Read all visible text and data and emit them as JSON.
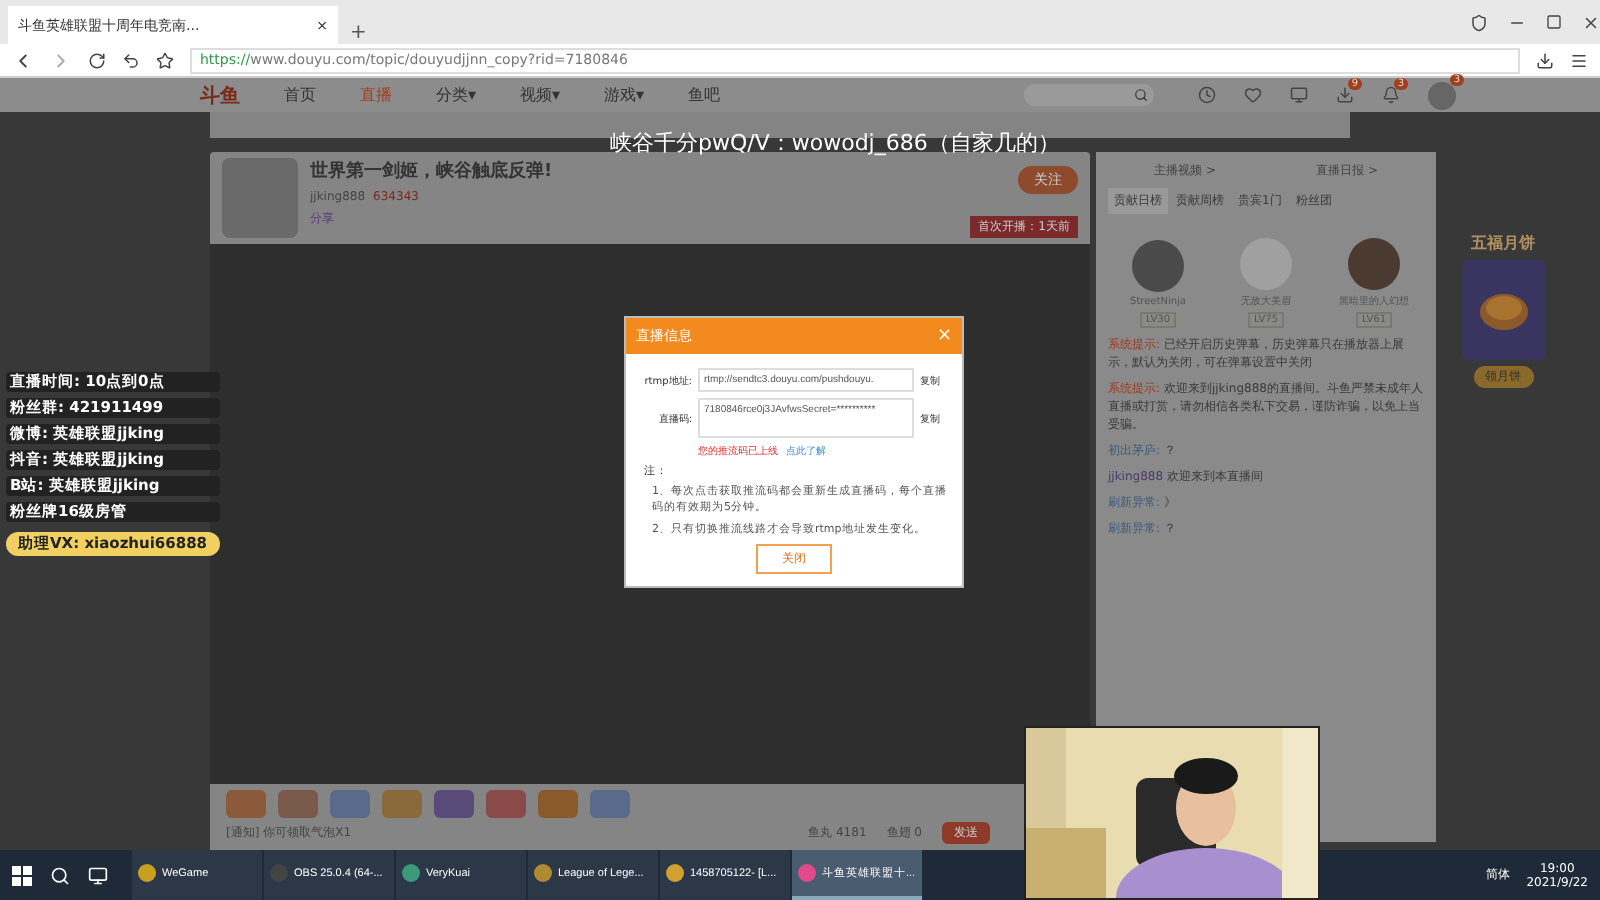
{
  "browser": {
    "tab_title": "斗鱼英雄联盟十周年电竞南...",
    "tab_close": "×",
    "new_tab": "+",
    "url": "https://www.douyu.com/topic/douyudjjnn_copy?rid=7180846"
  },
  "site_nav": {
    "logo": "斗鱼",
    "items": [
      {
        "label": "首页",
        "selected": false
      },
      {
        "label": "直播",
        "selected": true
      },
      {
        "label": "分类▾",
        "selected": false
      },
      {
        "label": "视频▾",
        "selected": false
      },
      {
        "label": "游戏▾",
        "selected": false
      },
      {
        "label": "鱼吧",
        "selected": false
      }
    ],
    "badges": [
      "9",
      "3"
    ],
    "avatar_badge": "3"
  },
  "caption": "峡谷千分pwQ/V：wowodj_686（自家几的）",
  "room": {
    "title": "世界第一剑姬，峡谷触底反弹!",
    "streamer": "jjking888",
    "heat": "634343",
    "follow": "关注",
    "first_live": "首次开播：1天前",
    "share": "分享"
  },
  "overlay_lines": [
    {
      "label": "直播时间:",
      "value": "10点到0点"
    },
    {
      "label": "粉丝群:",
      "value": "421911499"
    },
    {
      "label": "微博:",
      "value": "英雄联盟jjking"
    },
    {
      "label": "抖音:",
      "value": "英雄联盟jjking"
    },
    {
      "label": "B站:",
      "value": "英雄联盟jjking"
    },
    {
      "label": "粉丝牌16级房管"
    }
  ],
  "assistant": "助理VX: xiaozhui66888",
  "dialog": {
    "title": "直播信息",
    "close": "×",
    "fields": [
      {
        "label": "rtmp地址:",
        "value": "rtmp://sendtc3.douyu.com/pushdouyu.",
        "action": "复制"
      },
      {
        "label": "直播码:",
        "value": "7180846rce0j3JAvfwsSecret=**********",
        "action": "复制"
      }
    ],
    "warning": "您的推流码已上线",
    "link": "点此了解",
    "notes_title": "注：",
    "notes": [
      "1、每次点击获取推流码都会重新生成直播码，每个直播码的有效期为5分钟。",
      "2、只有切换推流线路才会导致rtmp地址发生变化。"
    ],
    "button": "关闭"
  },
  "chat": {
    "links": [
      "主播视频 >",
      "直播日报 >"
    ],
    "tabs": [
      {
        "label": "贡献日榜",
        "selected": true
      },
      {
        "label": "贡献周榜",
        "selected": false
      },
      {
        "label": "贵宾1门",
        "selected": false
      },
      {
        "label": "粉丝团",
        "selected": false
      }
    ],
    "ranks": [
      {
        "name": "StreetNinja",
        "level": "LV30"
      },
      {
        "name": "无敌大美眉",
        "level": "LV75"
      },
      {
        "name": "黑暗里的人幻想",
        "level": "LV61"
      }
    ],
    "messages": [
      {
        "kind": "system",
        "label": "系统提示:",
        "text": "已经开启历史弹幕，历史弹幕只在播放器上展示，默认为关闭，可在弹幕设置中关闭"
      },
      {
        "kind": "system",
        "label": "系统提示:",
        "text": "欢迎来到jjking888的直播间。斗鱼严禁未成年人直播或打赏，请勿相信各类私下交易，谨防诈骗，以免上当受骗。"
      },
      {
        "kind": "user",
        "label": "初出茅庐:",
        "text": "？"
      },
      {
        "kind": "welcome",
        "label": "jjking888",
        "text": "欢迎来到本直播间"
      },
      {
        "kind": "user",
        "label": "刷新异常:",
        "text": "》"
      },
      {
        "kind": "user",
        "label": "刷新异常:",
        "text": "？"
      }
    ]
  },
  "gift_bar": {
    "tip": "[通知] 你可领取气泡X1",
    "count_1": "鱼丸 4181",
    "count_2": "鱼翅 0",
    "send": "发送"
  },
  "promo": {
    "title": "五福月饼",
    "button": "领月饼"
  },
  "taskbar": {
    "apps": [
      {
        "label": "WeGame",
        "selected": false
      },
      {
        "label": "OBS 25.0.4 (64-...",
        "selected": false
      },
      {
        "label": "VeryKuai",
        "selected": false
      },
      {
        "label": "League of Lege...",
        "selected": false
      },
      {
        "label": "1458705122- [L...",
        "selected": false
      },
      {
        "label": "斗鱼英雄联盟十...",
        "selected": true
      }
    ],
    "ime": "简体",
    "time": "19:00",
    "date": "2021/9/22"
  }
}
